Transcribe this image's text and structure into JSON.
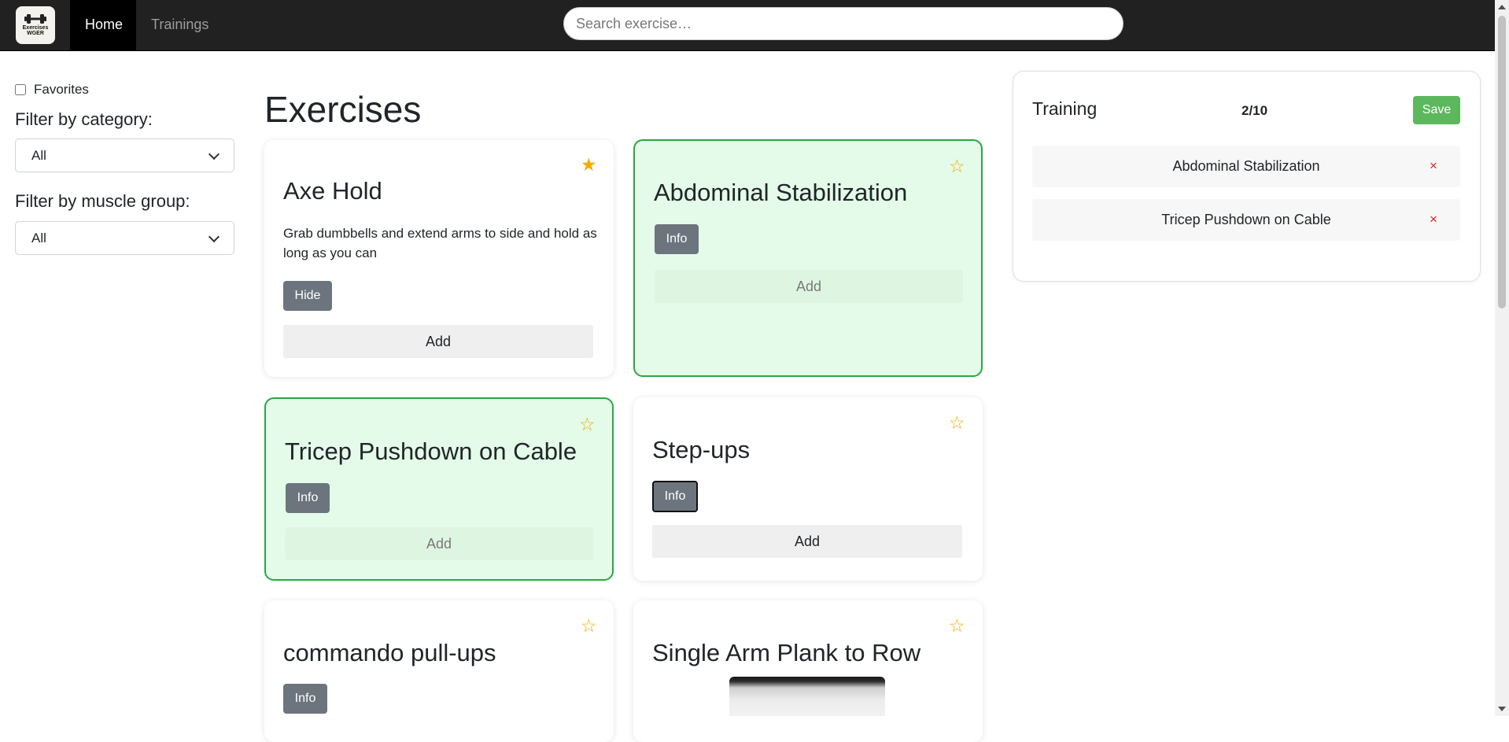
{
  "nav": {
    "logo_text_line1": "Exercises",
    "logo_text_line2": "WGER",
    "home_label": "Home",
    "trainings_label": "Trainings",
    "search_placeholder": "Search exercise…"
  },
  "sidebar": {
    "favorites_label": "Favorites",
    "favorites_checked": false,
    "category_label": "Filter by category:",
    "category_value": "All",
    "muscle_label": "Filter by muscle group:",
    "muscle_value": "All"
  },
  "main": {
    "title": "Exercises",
    "cards": [
      {
        "title": "Axe Hold",
        "favorite": true,
        "selected": false,
        "description": "Grab dumbbells and extend arms to side and hold as long as you can",
        "toggle_label": "Hide",
        "add_label": "Add"
      },
      {
        "title": "Abdominal Stabilization",
        "favorite": false,
        "selected": true,
        "toggle_label": "Info",
        "add_label": "Add"
      },
      {
        "title": "Tricep Pushdown on Cable",
        "favorite": false,
        "selected": true,
        "toggle_label": "Info",
        "add_label": "Add"
      },
      {
        "title": "Step-ups",
        "favorite": false,
        "selected": false,
        "toggle_label": "Info",
        "add_label": "Add"
      },
      {
        "title": "commando pull-ups",
        "favorite": false,
        "selected": false,
        "toggle_label": "Info"
      },
      {
        "title": "Single Arm Plank to Row",
        "favorite": false,
        "selected": false
      }
    ],
    "star_filled": "★",
    "star_empty": "☆"
  },
  "training": {
    "title": "Training",
    "count": "2/10",
    "save_label": "Save",
    "remove_symbol": "×",
    "items": [
      {
        "name": "Abdominal Stabilization"
      },
      {
        "name": "Tricep Pushdown on Cable"
      }
    ]
  },
  "colors": {
    "navbar": "#212121",
    "selected_card_bg": "#e3fbe8",
    "selected_card_border": "#28a745",
    "star": "#f0ad00",
    "save_button": "#5cb85c",
    "remove": "#e02020"
  }
}
